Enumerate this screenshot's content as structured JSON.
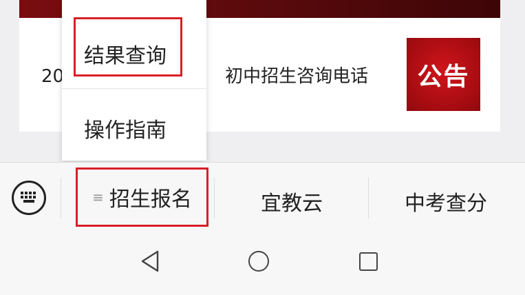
{
  "notice": {
    "text": "20　　　　　　　　　初中招生咨询电话",
    "badge": "公告"
  },
  "dropdown": {
    "items": [
      {
        "label": "结果查询"
      },
      {
        "label": "操作指南"
      }
    ]
  },
  "menubar": {
    "signup_icon": "≡",
    "signup": "招生报名",
    "yijiaoyun": "宜教云",
    "zhongkao": "中考查分"
  },
  "icons": {
    "keyboard": "keyboard-icon",
    "back": "back-triangle-icon",
    "home": "home-circle-icon",
    "recent": "recent-square-icon"
  },
  "colors": {
    "accent_red": "#d81e26",
    "badge_red": "#b00f14",
    "banner_dark_red": "#6a0b0e"
  }
}
